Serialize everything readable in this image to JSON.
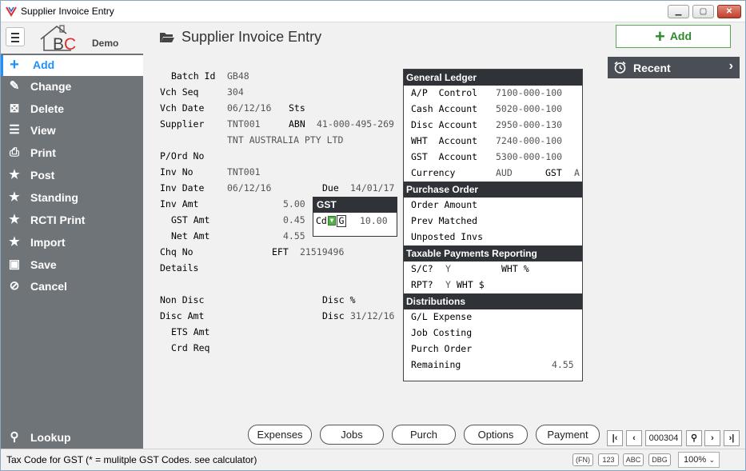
{
  "window": {
    "title": "Supplier Invoice Entry",
    "btn_min": "▁",
    "btn_max": "▢",
    "btn_close": "✕"
  },
  "header": {
    "logo_text": "BC",
    "logo_demo": "Demo",
    "page_title": "Supplier Invoice Entry",
    "add_label": "Add"
  },
  "sidebar": {
    "items": [
      {
        "label": "Add",
        "icon": "plus-icon"
      },
      {
        "label": "Change",
        "icon": "pencil-icon"
      },
      {
        "label": "Delete",
        "icon": "delete-icon"
      },
      {
        "label": "View",
        "icon": "list-icon"
      },
      {
        "label": "Print",
        "icon": "printer-icon"
      },
      {
        "label": "Post",
        "icon": "star-icon"
      },
      {
        "label": "Standing",
        "icon": "star-icon"
      },
      {
        "label": "RCTI Print",
        "icon": "star-icon"
      },
      {
        "label": "Import",
        "icon": "star-icon"
      },
      {
        "label": "Save",
        "icon": "floppy-icon"
      },
      {
        "label": "Cancel",
        "icon": "cancel-icon"
      }
    ],
    "lookup": "Lookup"
  },
  "form": {
    "batch_id_label": "Batch Id",
    "batch_id": "GB48",
    "vch_seq_label": "Vch Seq",
    "vch_seq": "304",
    "vch_date_label": "Vch Date",
    "vch_date": "06/12/16",
    "sts_label": "Sts",
    "supplier_label": "Supplier",
    "supplier": "TNT001",
    "abn_label": "ABN",
    "abn": "41-000-495-269",
    "supplier_name": "TNT AUSTRALIA PTY LTD",
    "pord_label": "P/Ord No",
    "inv_no_label": "Inv No",
    "inv_no": "TNT001",
    "inv_date_label": "Inv Date",
    "inv_date": "06/12/16",
    "due_label": "Due",
    "due": "14/01/17",
    "inv_amt_label": "Inv Amt",
    "inv_amt": "5.00",
    "gst_amt_label": "GST Amt",
    "gst_amt": "0.45",
    "net_amt_label": "Net Amt",
    "net_amt": "4.55",
    "chq_no_label": "Chq No",
    "eft_label": "EFT",
    "eft": "21519496",
    "details_label": "Details",
    "non_disc_label": "Non Disc",
    "disc_pct_label": "Disc %",
    "disc_amt_label": "Disc Amt",
    "disc_label": "Disc",
    "disc_date": "31/12/16",
    "ets_amt_label": "ETS Amt",
    "crd_req_label": "Crd Req"
  },
  "gst": {
    "header": "GST",
    "cd_label": "Cd",
    "code": "G",
    "rate": "10.00"
  },
  "panel": {
    "gl_header": "General Ledger",
    "ap_label": "A/P  Control",
    "ap": "7100-000-100",
    "cash_label": "Cash Account",
    "cash": "5020-000-100",
    "disc_label": "Disc Account",
    "disc": "2950-000-130",
    "wht_label": "WHT  Account",
    "wht": "7240-000-100",
    "gst_label": "GST  Account",
    "gst": "5300-000-100",
    "currency_label": "Currency",
    "currency": "AUD",
    "cur_gst_label": "GST",
    "cur_gst": "A",
    "po_header": "Purchase Order",
    "order_amount_label": "Order Amount",
    "prev_matched_label": "Prev Matched",
    "unposted_label": "Unposted Invs",
    "tpr_header": "Taxable Payments Reporting",
    "sc_label": "S/C?",
    "sc": "Y",
    "wht_pct_label": "WHT %",
    "rpt_label": "RPT?",
    "rpt": "Y",
    "wht_dollar_label": "WHT $",
    "dist_header": "Distributions",
    "gl_expense_label": "G/L Expense",
    "job_costing_label": "Job Costing",
    "purch_order_label": "Purch Order",
    "remaining_label": "Remaining",
    "remaining": "4.55"
  },
  "recent": {
    "label": "Recent"
  },
  "bottom": {
    "buttons": [
      "Expenses",
      "Jobs",
      "Purch",
      "Options",
      "Payment"
    ],
    "record": "000304"
  },
  "status": {
    "message": "Tax Code for GST (* = mulitple GST Codes. see calculator)",
    "chips": [
      "(FN)",
      "123",
      "ABC",
      "DBG"
    ],
    "zoom": "100%"
  },
  "colors": {
    "sidebar": "#6f7479",
    "section_header": "#2f3338",
    "accent": "#1e90ff",
    "add_green": "#2e8b2e"
  }
}
